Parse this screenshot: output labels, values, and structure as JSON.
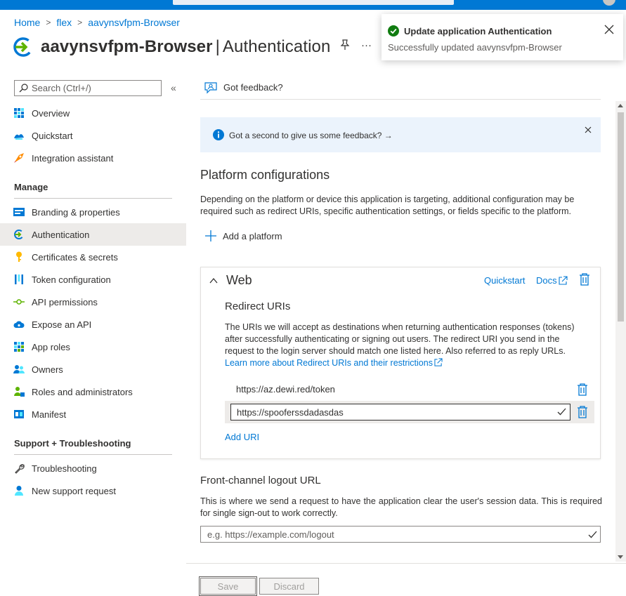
{
  "breadcrumb": {
    "home": "Home",
    "sep": ">",
    "tenant": "flex",
    "app": "aavynsvfpm-Browser"
  },
  "page": {
    "app_name": "aavynsvfpm-Browser",
    "pipe": "|",
    "section": "Authentication",
    "more": "···"
  },
  "toast": {
    "title": "Update application Authentication",
    "message": "Successfully updated aavynsvfpm-Browser"
  },
  "sidebar": {
    "search_placeholder": "Search (Ctrl+/)",
    "collapse_label": "«",
    "top_items": [
      {
        "label": "Overview",
        "icon": "overview-icon"
      },
      {
        "label": "Quickstart",
        "icon": "quickstart-icon"
      },
      {
        "label": "Integration assistant",
        "icon": "rocket-icon"
      }
    ],
    "manage_heading": "Manage",
    "manage_items": [
      {
        "label": "Branding & properties",
        "icon": "branding-icon"
      },
      {
        "label": "Authentication",
        "icon": "authentication-icon",
        "active": true
      },
      {
        "label": "Certificates & secrets",
        "icon": "key-icon"
      },
      {
        "label": "Token configuration",
        "icon": "token-icon"
      },
      {
        "label": "API permissions",
        "icon": "api-permissions-icon"
      },
      {
        "label": "Expose an API",
        "icon": "cloud-icon"
      },
      {
        "label": "App roles",
        "icon": "app-roles-icon"
      },
      {
        "label": "Owners",
        "icon": "owners-icon"
      },
      {
        "label": "Roles and administrators",
        "icon": "roles-icon"
      },
      {
        "label": "Manifest",
        "icon": "manifest-icon"
      }
    ],
    "support_heading": "Support + Troubleshooting",
    "support_items": [
      {
        "label": "Troubleshooting",
        "icon": "wrench-icon"
      },
      {
        "label": "New support request",
        "icon": "support-icon"
      }
    ]
  },
  "command_bar": {
    "feedback": "Got feedback?"
  },
  "info_banner": {
    "text": "Got a second to give us some feedback? →"
  },
  "platform": {
    "heading": "Platform configurations",
    "description": "Depending on the platform or device this application is targeting, additional configuration may be required such as redirect URIs, specific authentication settings, or fields specific to the platform.",
    "add_label": "Add a platform"
  },
  "web_card": {
    "title": "Web",
    "quickstart": "Quickstart",
    "docs": "Docs",
    "redirect_heading": "Redirect URIs",
    "redirect_desc": "The URIs we will accept as destinations when returning authentication responses (tokens) after successfully authenticating or signing out users. The redirect URI you send in the request to the login server should match one listed here. Also referred to as reply URLs.",
    "redirect_link": "Learn more about Redirect URIs and their restrictions",
    "uris": [
      "https://az.dewi.red/token"
    ],
    "editing_uri": "https://spooferssdadasdas",
    "add_uri": "Add URI"
  },
  "logout": {
    "heading": "Front-channel logout URL",
    "description": "This is where we send a request to have the application clear the user's session data. This is required for single sign-out to work correctly.",
    "placeholder": "e.g. https://example.com/logout"
  },
  "footer": {
    "save": "Save",
    "discard": "Discard"
  },
  "colors": {
    "accent": "#0078d4",
    "success": "#107c10",
    "active_nav_bg": "#edebe9",
    "info_bg": "#ebf3fc"
  }
}
